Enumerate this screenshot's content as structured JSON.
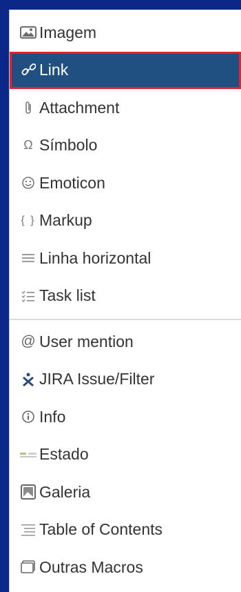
{
  "colors": {
    "selected_bg": "#205081",
    "selected_border": "#e0232f",
    "text": "#333333",
    "icon": "#707070"
  },
  "menu": {
    "group1": [
      {
        "label": "Imagem",
        "icon": "image-icon"
      },
      {
        "label": "Link",
        "icon": "link-icon",
        "selected": true
      },
      {
        "label": "Attachment",
        "icon": "paperclip-icon"
      },
      {
        "label": "Símbolo",
        "icon": "omega-icon"
      },
      {
        "label": "Emoticon",
        "icon": "smiley-icon"
      },
      {
        "label": "Markup",
        "icon": "braces-icon"
      },
      {
        "label": "Linha horizontal",
        "icon": "horizontal-rule-icon"
      },
      {
        "label": "Task list",
        "icon": "task-list-icon"
      }
    ],
    "group2": [
      {
        "label": "User mention",
        "icon": "at-sign-icon"
      },
      {
        "label": "JIRA Issue/Filter",
        "icon": "jira-icon"
      },
      {
        "label": "Info",
        "icon": "info-icon"
      },
      {
        "label": "Estado",
        "icon": "status-lozenge-icon"
      },
      {
        "label": "Galeria",
        "icon": "gallery-icon"
      },
      {
        "label": "Table of Contents",
        "icon": "table-of-contents-icon"
      },
      {
        "label": "Outras Macros",
        "icon": "macros-icon"
      }
    ]
  }
}
